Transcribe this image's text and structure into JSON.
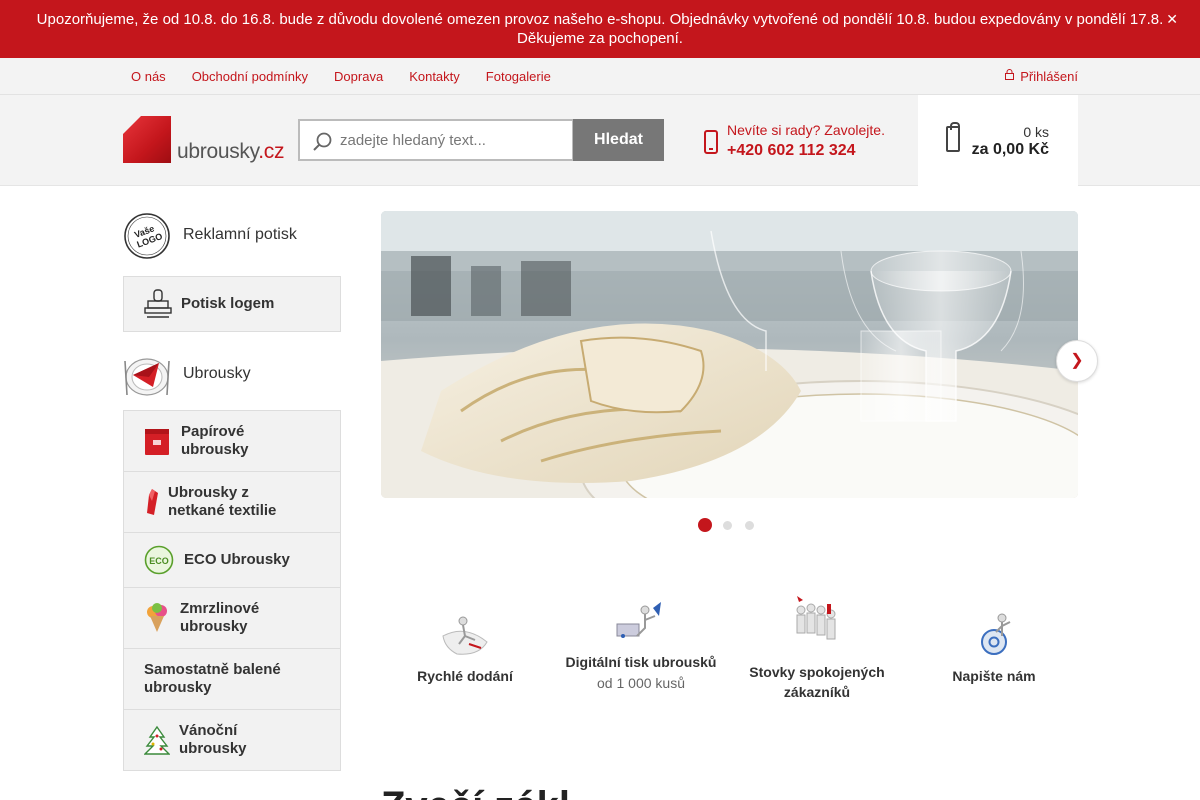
{
  "notice": {
    "line1": "Upozorňujeme, že od 10.8. do 16.8. bude z důvodu dovolené omezen provoz našeho e-shopu. Objednávky vytvořené od pondělí 10.8. budou expedovány v pondělí 17.8.",
    "line2": "Děkujeme za pochopení.",
    "close_icon": "close-icon"
  },
  "topnav": {
    "links": [
      "O nás",
      "Obchodní podmínky",
      "Doprava",
      "Kontakty",
      "Fotogalerie"
    ],
    "login": "Přihlášení",
    "login_icon": "lock-icon"
  },
  "header": {
    "logo_text": "ubrousky",
    "logo_tld": ".cz",
    "search_placeholder": "zadejte hledaný text...",
    "search_button": "Hledat",
    "help_question": "Nevíte si rady? Zavolejte.",
    "phone": "+420 602 112 324",
    "cart_count": "0 ks",
    "cart_total": "za 0,00 Kč"
  },
  "sidebar": {
    "section1": {
      "title": "Reklamní potisk",
      "logo_badge_top": "Vaše",
      "logo_badge_bottom": "LOGO",
      "items": [
        "Potisk logem"
      ]
    },
    "section2": {
      "title": "Ubrousky",
      "items": [
        "Papírové ubrousky",
        "Ubrousky z netkané textilie",
        "ECO Ubrousky",
        "Zmrzlinové ubrousky",
        "Samostatně balené ubrousky",
        "Vánoční ubrousky"
      ],
      "eco_badge": "ECO"
    }
  },
  "slider": {
    "slides": 3,
    "active": 1,
    "next_icon": "chevron-right-icon"
  },
  "benefits": [
    {
      "title": "Rychlé dodání",
      "subtitle": ""
    },
    {
      "title": "Digitální tisk ubrousků",
      "subtitle": "od 1 000 kusů"
    },
    {
      "title": "Stovky spokojených zákazníků",
      "subtitle": ""
    },
    {
      "title": "Napište nám",
      "subtitle": ""
    }
  ],
  "main": {
    "heading": "Zvečí zákl"
  },
  "colors": {
    "brand_red": "#c4161c",
    "button_gray": "#777777",
    "panel_gray": "#f2f2f2"
  }
}
